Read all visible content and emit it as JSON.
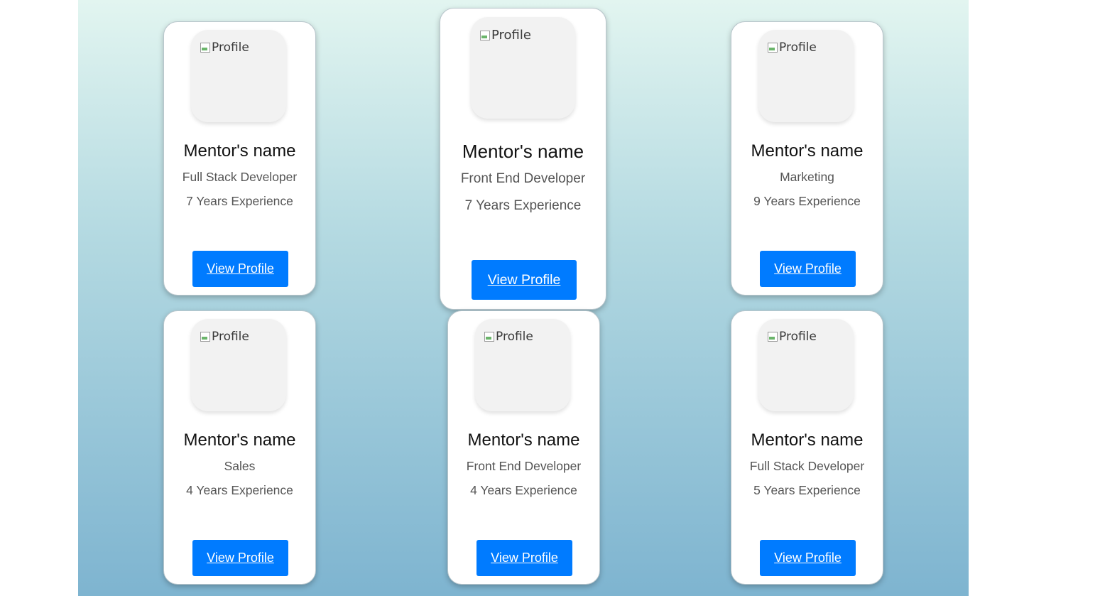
{
  "colors": {
    "button_bg": "#007bff",
    "button_text": "#ffffff",
    "card_bg": "#ffffff",
    "gradient_top": "#e2f5f0",
    "gradient_bottom": "#7eb4d0"
  },
  "mentors": [
    {
      "image_alt": "Profile",
      "name": "Mentor's name",
      "role": "Full Stack Developer",
      "experience": "7 Years Experience",
      "button_label": "View Profile"
    },
    {
      "image_alt": "Profile",
      "name": "Mentor's name",
      "role": "Front End Developer",
      "experience": "7 Years Experience",
      "button_label": "View Profile"
    },
    {
      "image_alt": "Profile",
      "name": "Mentor's name",
      "role": "Marketing",
      "experience": "9 Years Experience",
      "button_label": "View Profile"
    },
    {
      "image_alt": "Profile",
      "name": "Mentor's name",
      "role": "Sales",
      "experience": "4 Years Experience",
      "button_label": "View Profile"
    },
    {
      "image_alt": "Profile",
      "name": "Mentor's name",
      "role": "Front End Developer",
      "experience": "4 Years Experience",
      "button_label": "View Profile"
    },
    {
      "image_alt": "Profile",
      "name": "Mentor's name",
      "role": "Full Stack Developer",
      "experience": "5 Years Experience",
      "button_label": "View Profile"
    }
  ]
}
